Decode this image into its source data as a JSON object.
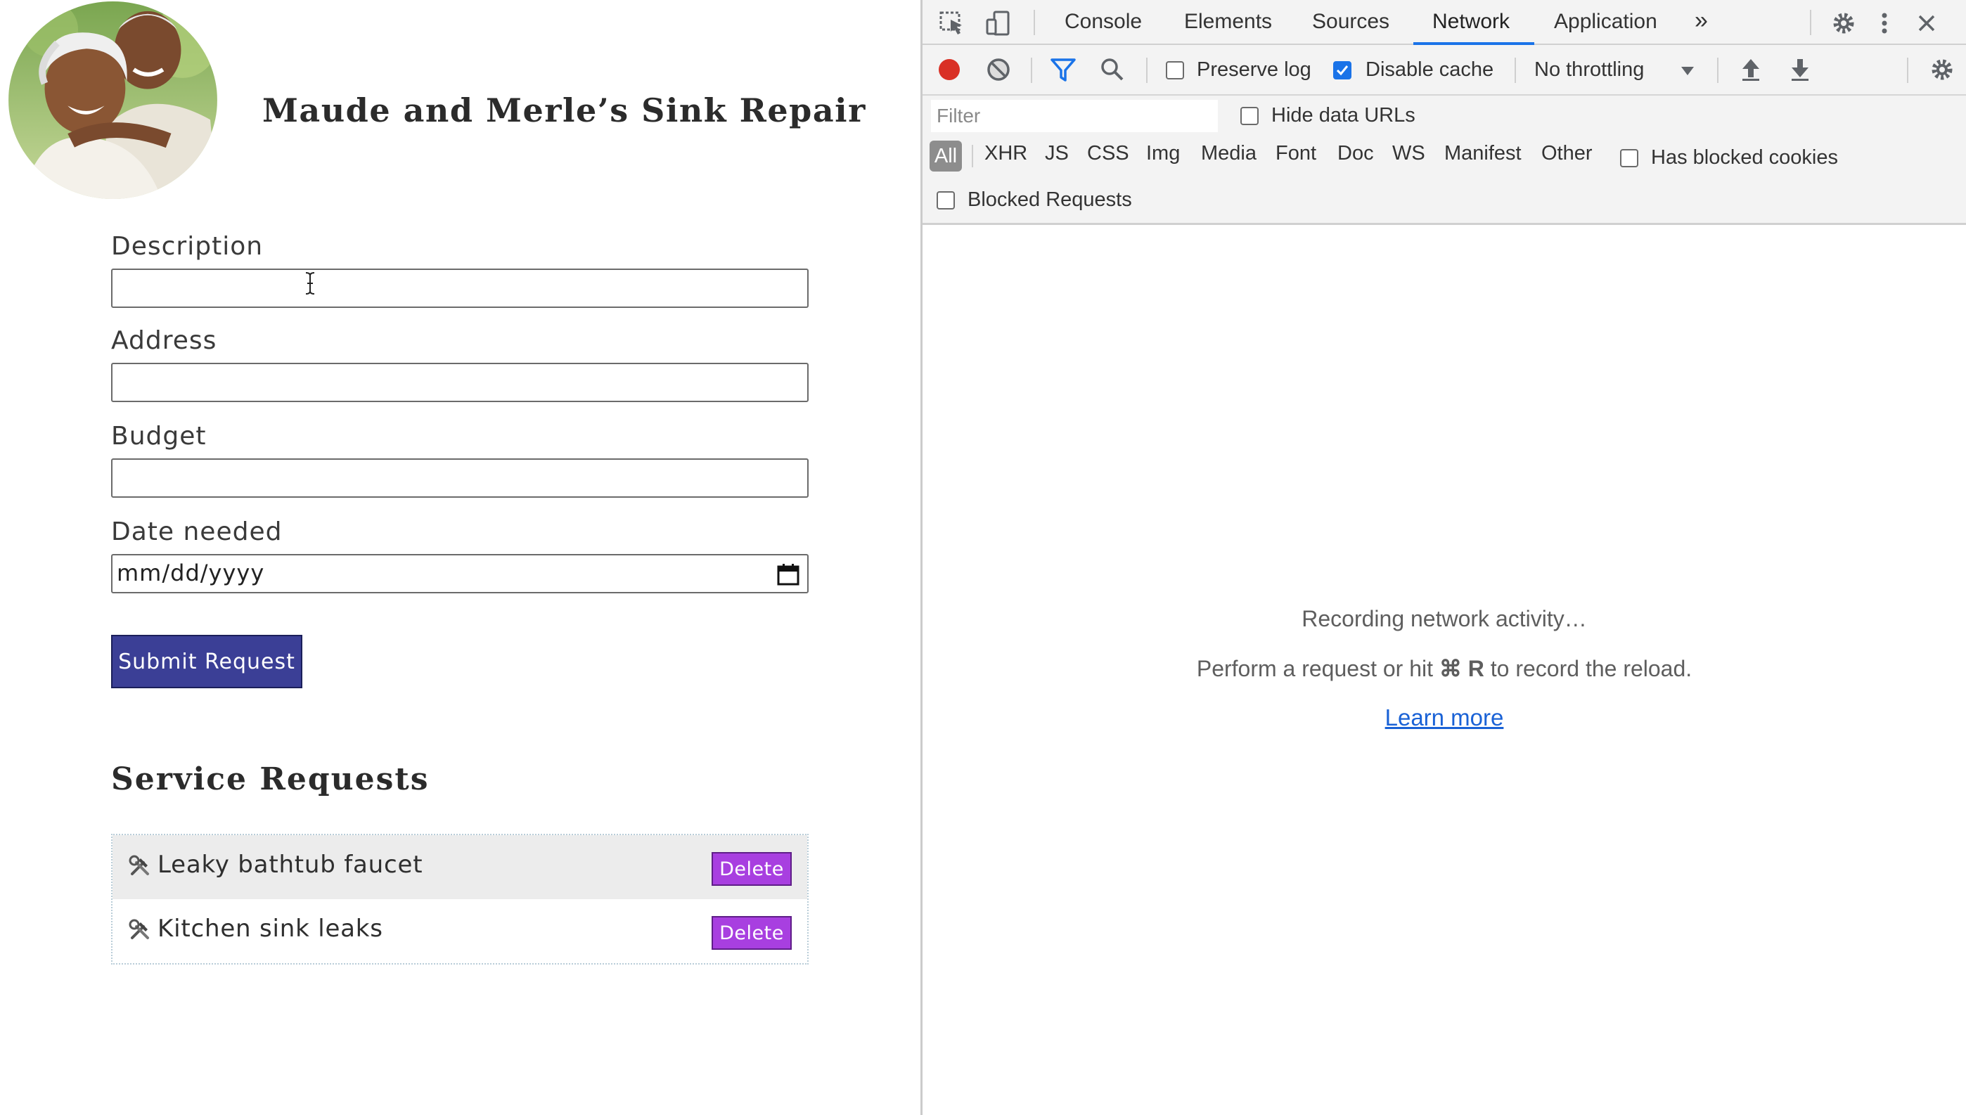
{
  "page": {
    "site_title": "Maude and Merle’s Sink Repair",
    "form": {
      "description": {
        "label": "Description",
        "value": "",
        "placeholder": ""
      },
      "address": {
        "label": "Address",
        "value": "",
        "placeholder": ""
      },
      "budget": {
        "label": "Budget",
        "value": "",
        "placeholder": ""
      },
      "date_needed": {
        "label": "Date needed",
        "value": "mm/dd/yyyy"
      },
      "submit_label": "Submit Request"
    },
    "requests_title": "Service Requests",
    "requests": [
      {
        "icon": "hammer-and-wrench-icon",
        "text": "Leaky bathtub faucet",
        "delete_label": "Delete"
      },
      {
        "icon": "hammer-and-wrench-icon",
        "text": "Kitchen sink leaks",
        "delete_label": "Delete"
      }
    ]
  },
  "devtools": {
    "tabs": [
      {
        "label": "Console",
        "active": false
      },
      {
        "label": "Elements",
        "active": false
      },
      {
        "label": "Sources",
        "active": false
      },
      {
        "label": "Network",
        "active": true
      },
      {
        "label": "Application",
        "active": false
      }
    ],
    "more_tabs_symbol": "»",
    "toolbar": {
      "preserve_log": {
        "label": "Preserve log",
        "checked": false
      },
      "disable_cache": {
        "label": "Disable cache",
        "checked": true
      },
      "throttling": "No throttling"
    },
    "filter": {
      "placeholder": "Filter",
      "hide_data_urls": {
        "label": "Hide data URLs",
        "checked": false
      },
      "types": [
        "All",
        "XHR",
        "JS",
        "CSS",
        "Img",
        "Media",
        "Font",
        "Doc",
        "WS",
        "Manifest",
        "Other"
      ],
      "selected_type": "All",
      "has_blocked_cookies": {
        "label": "Has blocked cookies",
        "checked": false
      },
      "blocked_requests": {
        "label": "Blocked Requests",
        "checked": false
      }
    },
    "empty_state": {
      "line1": "Recording network activity…",
      "line2_prefix": "Perform a request or hit ",
      "line2_shortcut": "⌘ R",
      "line2_suffix": " to record the reload.",
      "learn_more": "Learn more"
    },
    "colors": {
      "accent": "#1a73e8",
      "record": "#d93025",
      "filter_icon": "#1a73e8"
    }
  }
}
